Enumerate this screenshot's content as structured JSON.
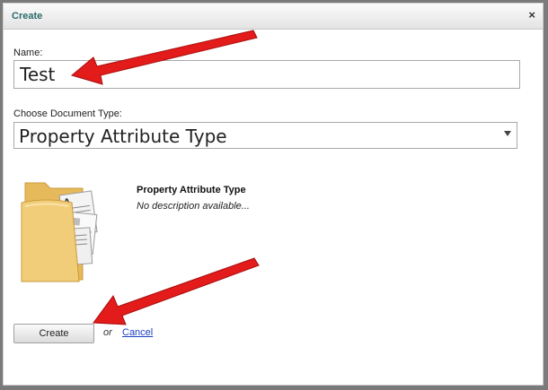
{
  "dialog": {
    "title": "Create",
    "close_glyph": "×"
  },
  "form": {
    "name_label": "Name:",
    "name_value": "Test",
    "doctype_label": "Choose Document Type:",
    "doctype_selected": "Property Attribute Type"
  },
  "preview": {
    "icon": "folder-document-icon",
    "title": "Property Attribute Type",
    "description": "No description available..."
  },
  "actions": {
    "create_label": "Create",
    "or_text": "or",
    "cancel_label": "Cancel"
  },
  "colors": {
    "title_text": "#2b6a6a",
    "annotation_arrow": "#e31b1b",
    "cancel_link": "#1a3fbf"
  }
}
